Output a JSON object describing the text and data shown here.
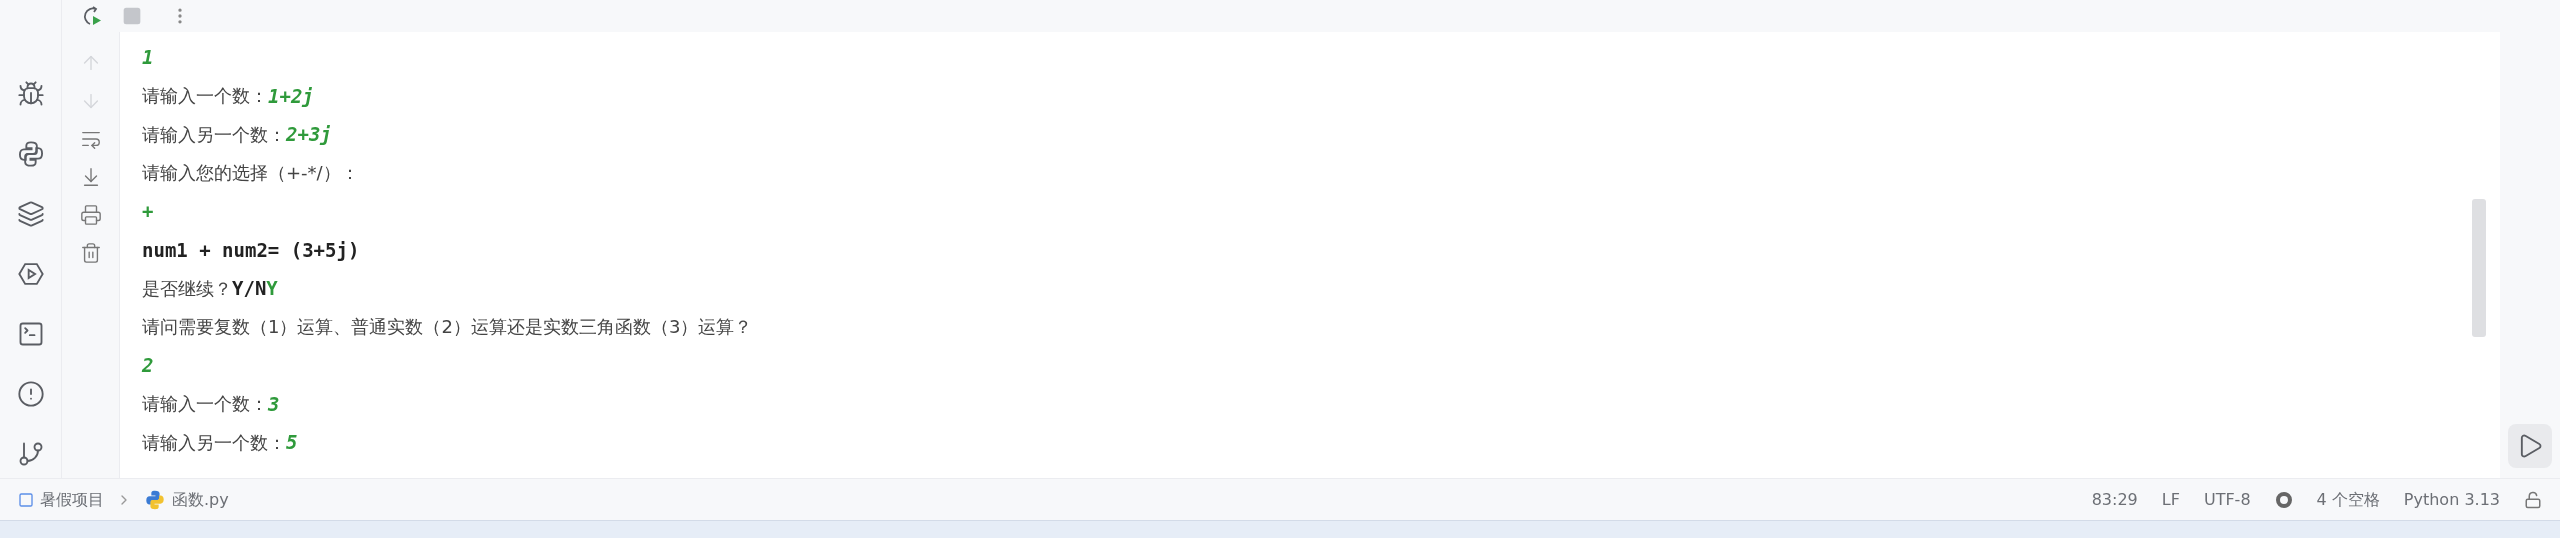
{
  "navigation": {
    "previous_disabled": true,
    "next_disabled": true
  },
  "console": {
    "lines": [
      [
        {
          "kind": "input",
          "text": "1"
        }
      ],
      [
        {
          "kind": "prompt",
          "text": "请输入一个数："
        },
        {
          "kind": "input",
          "text": "1+2j"
        }
      ],
      [
        {
          "kind": "prompt",
          "text": "请输入另一个数："
        },
        {
          "kind": "input",
          "text": "2+3j"
        }
      ],
      [
        {
          "kind": "prompt",
          "text": "请输入您的选择（+-*/）："
        }
      ],
      [
        {
          "kind": "input",
          "text": "+"
        }
      ],
      [
        {
          "kind": "output",
          "text": "num1 + num2= (3+5j)"
        }
      ],
      [
        {
          "kind": "prompt",
          "text": "是否继续？"
        },
        {
          "kind": "output",
          "text": "Y/N"
        },
        {
          "kind": "answer",
          "text": "Y"
        }
      ],
      [
        {
          "kind": "prompt",
          "text": "请问需要复数（1）运算、普通实数（2）运算还是实数三角函数（3）运算？"
        }
      ],
      [
        {
          "kind": "input",
          "text": "2"
        }
      ],
      [
        {
          "kind": "prompt",
          "text": "请输入一个数："
        },
        {
          "kind": "input",
          "text": "3"
        }
      ],
      [
        {
          "kind": "prompt",
          "text": "请输入另一个数："
        },
        {
          "kind": "input",
          "text": "5"
        }
      ]
    ]
  },
  "breadcrumb": {
    "project": "暑假项目",
    "file": "函数.py"
  },
  "status_bar": {
    "position": "83:29",
    "line_separator": "LF",
    "encoding": "UTF-8",
    "indent": "4 个空格",
    "interpreter": "Python 3.13"
  }
}
